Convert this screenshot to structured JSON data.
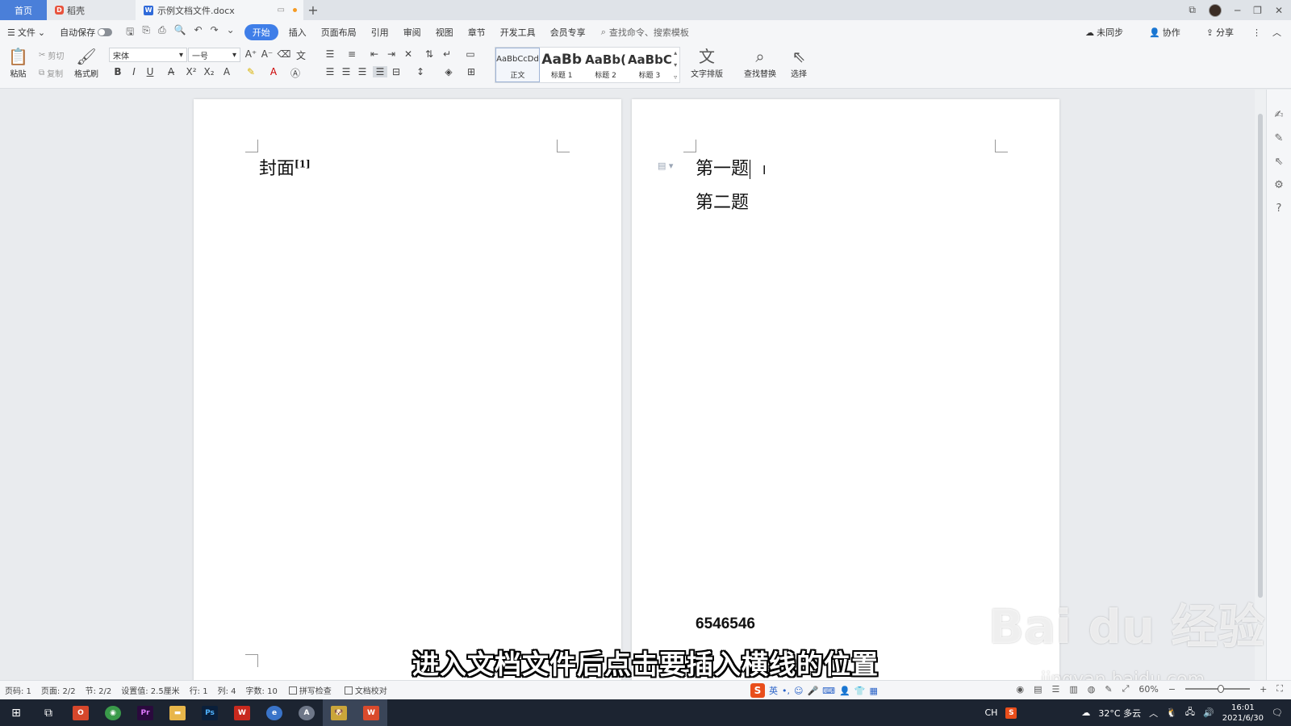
{
  "tabs": {
    "home": "首页",
    "daoke": "稻壳",
    "doc": "示例文档文件.docx",
    "add": "+"
  },
  "menu": {
    "file": "文件",
    "autosave": "自动保存",
    "items": [
      "开始",
      "插入",
      "页面布局",
      "引用",
      "审阅",
      "视图",
      "章节",
      "开发工具",
      "会员专享"
    ],
    "search_placeholder": "查找命令、搜索模板",
    "sync": "未同步",
    "collab": "协作",
    "share": "分享"
  },
  "ribbon": {
    "paste": "粘贴",
    "cut": "剪切",
    "copy": "复制",
    "format_painter": "格式刷",
    "font_name": "宋体",
    "font_size": "一号",
    "styles": [
      {
        "sample": "AaBbCcDd",
        "label": "正文"
      },
      {
        "sample": "AaBb",
        "label": "标题 1"
      },
      {
        "sample": "AaBb(",
        "label": "标题 2"
      },
      {
        "sample": "AaBbC(",
        "label": "标题 3"
      }
    ],
    "text_layout": "文字排版",
    "find_replace": "查找替换",
    "select": "选择"
  },
  "document": {
    "left_page_heading": "封面",
    "left_page_footnote_ref": "[1]",
    "right_line1": "第一题",
    "right_line2": "第二题",
    "right_footer_number": "6546546"
  },
  "subtitle": "进入文档文件后点击要插入横线的位置",
  "watermark": {
    "brand": "Bai du 经验",
    "url": "jingyan.baidu.com"
  },
  "statusbar": {
    "page_num": "页码: 1",
    "pages": "页面: 2/2",
    "section": "节: 2/2",
    "setting": "设置值: 2.5厘米",
    "row": "行: 1",
    "col": "列: 4",
    "words": "字数: 10",
    "spell": "拼写检查",
    "proof": "文档校对",
    "ime_lang": "英",
    "zoom": "60%"
  },
  "taskbar": {
    "ime": "CH",
    "weather": "32°C 多云",
    "time": "16:01",
    "date": "2021/6/30"
  }
}
